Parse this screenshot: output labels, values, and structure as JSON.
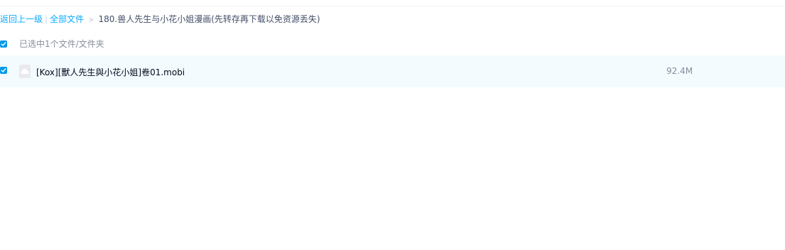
{
  "breadcrumb": {
    "back_label": "返回上一级",
    "separator": "|",
    "all_files_label": "全部文件",
    "arrow": ">",
    "current_folder": "180.兽人先生与小花小姐漫画(先转存再下载以免资源丢失)"
  },
  "selection": {
    "checked": true,
    "text": "已选中1个文件/文件夹"
  },
  "files": [
    {
      "checked": true,
      "icon": "cloud-file-icon",
      "name": "[Kox][獸人先生與小花小姐]卷01.mobi",
      "size": "92.4M"
    }
  ],
  "colors": {
    "accent": "#09aaff",
    "checkbox": "#0098ea",
    "row_selected_bg": "#f4fbff",
    "muted_text": "#878c9c"
  }
}
